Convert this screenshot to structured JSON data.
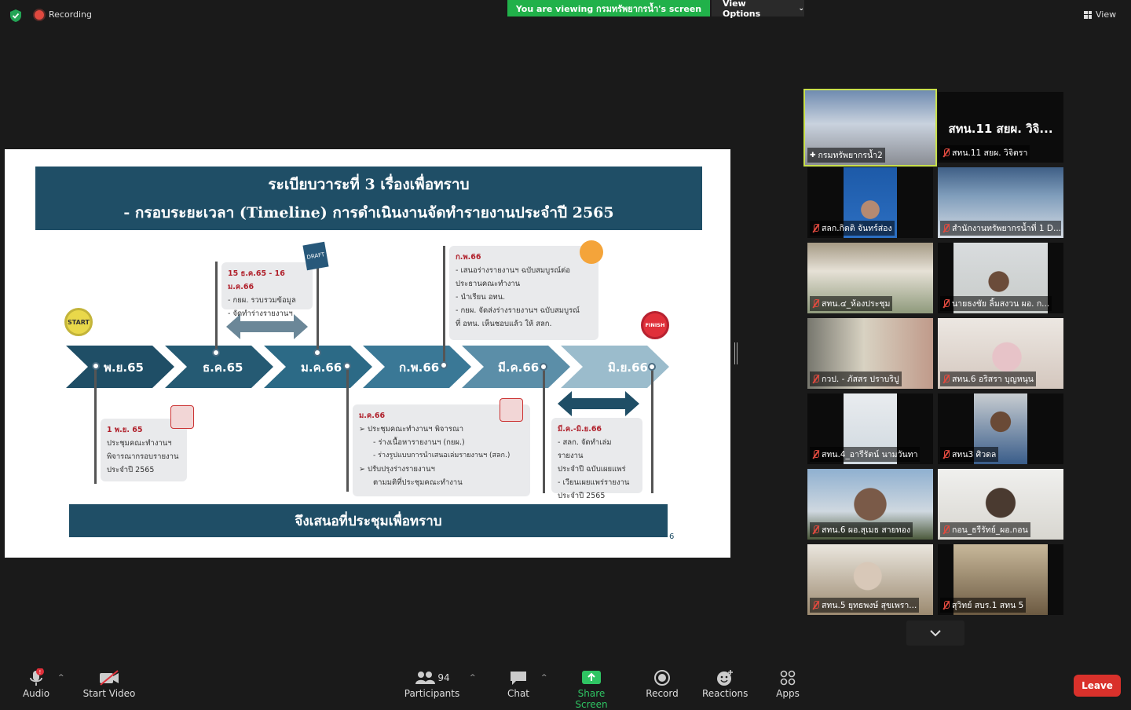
{
  "top_bar": {
    "recording_label": "Recording",
    "viewing_banner": "You are viewing กรมทรัพยากรน้ำ's screen",
    "view_options_label": "View Options",
    "view_label": "View"
  },
  "slide": {
    "header_line1": "ระเบียบวาระที่ 3 เรื่องเพื่อทราบ",
    "header_line2": "- กรอบระยะเวลา (Timeline) การดำเนินงานจัดทำรายงานประจำปี 2565",
    "start_badge": "START",
    "finish_badge": "FINISH",
    "draft_label": "DRAFT",
    "months": [
      "พ.ย.65",
      "ธ.ค.65",
      "ม.ค.66",
      "ก.พ.66",
      "มี.ค.66",
      "มิ.ย.66"
    ],
    "card_dec": {
      "date": "15 ธ.ค.65 - 16 ม.ค.66",
      "line1": "- กยผ. รวบรวมข้อมูล",
      "line2": "- จัดทำร่างรายงานฯ"
    },
    "card_feb": {
      "date": "ก.พ.66",
      "line1": "- เสนอร่างรายงานฯ ฉบับสมบูรณ์ต่อ",
      "line2": "ประธานคณะทำงาน",
      "line3": "- นำเรียน อทน.",
      "line4": "- กยผ. จัดส่งร่างรายงานฯ ฉบับสมบูรณ์",
      "line5": "ที่ อทน. เห็นชอบแล้ว ให้ สลก."
    },
    "card_nov": {
      "date": "1 พ.ย. 65",
      "line1": "ประชุมคณะทำงานฯ",
      "line2": "พิจารณากรอบรายงาน",
      "line3": "ประจำปี 2565"
    },
    "card_jan": {
      "date": "ม.ค.66",
      "line1": "ประชุมคณะทำงานฯ พิจารณา",
      "line2": "- ร่างเนื้อหารายงานฯ (กยผ.)",
      "line3": "- ร่างรูปแบบการนำเสนอเล่มรายงานฯ (สลก.)",
      "line4": "ปรับปรุงร่างรายงานฯ",
      "line5": "ตามมติที่ประชุมคณะทำงาน"
    },
    "card_mar": {
      "date": "มี.ค.-มิ.ย.66",
      "line1": "- สลก. จัดทำเล่มรายงาน",
      "line2": "ประจำปี ฉบับเผยแพร่",
      "line3": "- เวียนเผยแพร่รายงาน",
      "line4": "ประจำปี 2565"
    },
    "footer": "จึงเสนอที่ประชุมเพื่อทราบ",
    "page_number": "6"
  },
  "gallery": {
    "tiles": [
      {
        "name": "กรมทรัพยากรน้ำ2"
      },
      {
        "name": "สทน.11 สยผ. วิจิตรา",
        "big": "สทน.11 สยผ. วิจิ..."
      },
      {
        "name": "สลก.กิตติ จันทร์ส่อง"
      },
      {
        "name": "สำนักงานทรัพยากรน้ำที่ 1 D..."
      },
      {
        "name": "สทน.๔_ห้องประชุม"
      },
      {
        "name": "นายธงชัย ลิ้มสงวน ผอ. ก..."
      },
      {
        "name": "กวป. - ภัสสร ปราบริปู"
      },
      {
        "name": "สทน.6 อริสรา บุญหนุน"
      },
      {
        "name": "สทน.4_อารีรัตน์ นามวันทา"
      },
      {
        "name": "สทน3 ศิวดล"
      },
      {
        "name": "สทน.6 ผอ.สุเมธ สายทอง"
      },
      {
        "name": "กอน_ธรีรัทย์_ผอ.กอน"
      },
      {
        "name": "สทน.5 ยุทธพงษ์ สุขเพรา..."
      },
      {
        "name": "สุวิทย์ สบร.1 สทน 5"
      }
    ]
  },
  "toolbar": {
    "audio": "Audio",
    "start_video": "Start Video",
    "participants": "Participants",
    "participants_count": "94",
    "chat": "Chat",
    "share_screen": "Share Screen",
    "record": "Record",
    "reactions": "Reactions",
    "apps": "Apps",
    "leave": "Leave"
  }
}
